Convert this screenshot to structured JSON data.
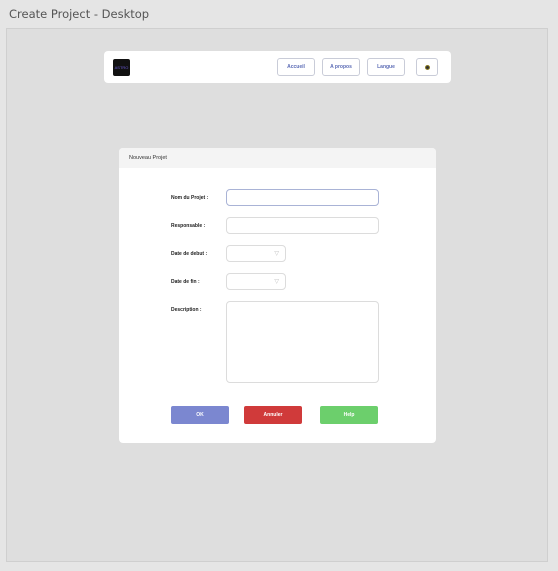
{
  "window": {
    "title": "Create Project - Desktop"
  },
  "navbar": {
    "logo_text": "ASTRO",
    "buttons": [
      {
        "label": "Accueil"
      },
      {
        "label": "A propos"
      },
      {
        "label": "Langue"
      }
    ],
    "theme_toggle_icon": "theme-dot-icon"
  },
  "form": {
    "header": "Nouveau Projet",
    "fields": {
      "name": {
        "label": "Nom du Projet :",
        "value": "",
        "placeholder": ""
      },
      "owner": {
        "label": "Responsable :",
        "value": "",
        "placeholder": ""
      },
      "start_date": {
        "label": "Date de debut :",
        "value": ""
      },
      "end_date": {
        "label": "Date de fin :",
        "value": ""
      },
      "description": {
        "label": "Description :",
        "value": ""
      }
    },
    "actions": {
      "ok": {
        "label": "OK",
        "color": "#7b87d0"
      },
      "cancel": {
        "label": "Annuler",
        "color": "#d03a3a"
      },
      "help": {
        "label": "Help",
        "color": "#6ccf6c"
      }
    },
    "chevron_glyph": "▽"
  }
}
